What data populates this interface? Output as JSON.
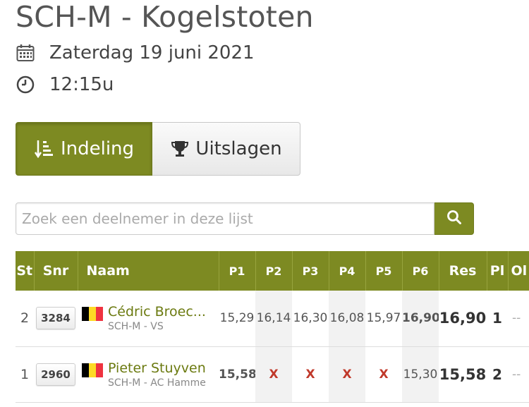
{
  "event": {
    "title": "SCH-M - Kogelstoten",
    "date": "Zaterdag 19 juni 2021",
    "time": "12:15u",
    "date_icon": "calendar-icon",
    "time_icon": "clock-icon"
  },
  "tabs": [
    {
      "label": "Indeling",
      "icon": "sort-list-icon",
      "active": true
    },
    {
      "label": "Uitslagen",
      "icon": "trophy-icon",
      "active": false
    }
  ],
  "search": {
    "placeholder": "Zoek een deelnemer in deze lijst",
    "value": "",
    "icon": "search-icon"
  },
  "table": {
    "headers": {
      "st": "St",
      "snr": "Snr",
      "naam": "Naam",
      "p1": "P1",
      "p2": "P2",
      "p3": "P3",
      "p4": "P4",
      "p5": "P5",
      "p6": "P6",
      "res": "Res",
      "pl": "Pl",
      "ol": "Ol"
    },
    "rows": [
      {
        "st": "2",
        "snr": "3284",
        "name": "Cédric Broec...",
        "club": "SCH-M - VS",
        "flag": "BE",
        "p1": "15,29",
        "p2": "16,14",
        "p3": "16,30",
        "p4": "16,08",
        "p5": "15,97",
        "p6": "16,90",
        "res": "16,90",
        "pl": "1",
        "ol": "--"
      },
      {
        "st": "1",
        "snr": "2960",
        "name": "Pieter Stuyven",
        "club": "SCH-M - AC Hamme",
        "flag": "BE",
        "p1": "15,58",
        "p2": "X",
        "p3": "X",
        "p4": "X",
        "p5": "X",
        "p6": "15,30",
        "res": "15,58",
        "pl": "2",
        "ol": "--"
      }
    ]
  },
  "colors": {
    "accent": "#7d8a22",
    "athlete_link": "#6b7a10",
    "foul": "#c0392b"
  }
}
